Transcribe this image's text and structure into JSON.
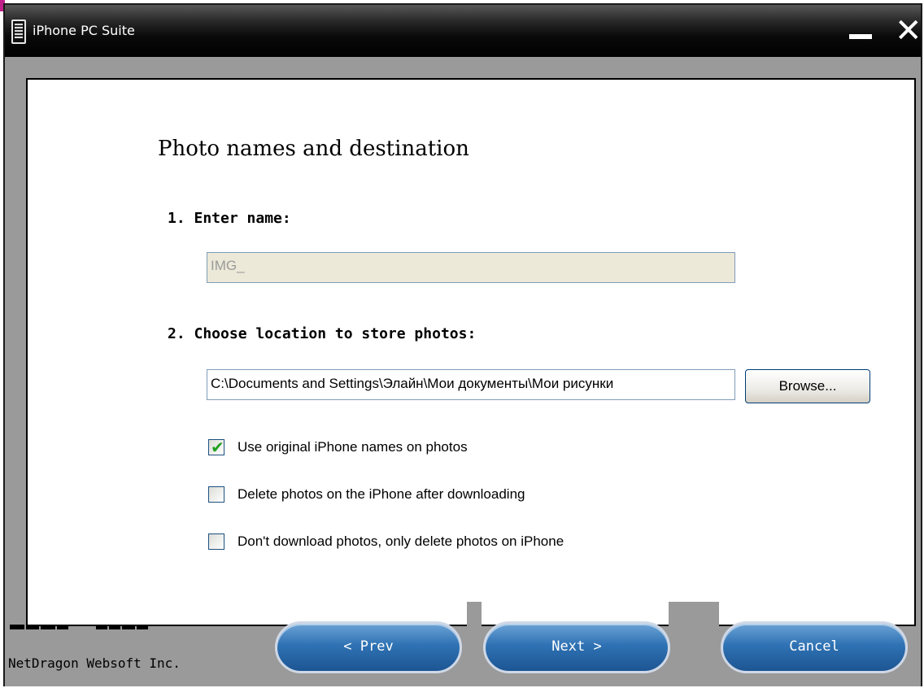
{
  "window": {
    "title": "iPhone PC Suite",
    "minimize_glyph": "—",
    "close_glyph": "✕"
  },
  "page": {
    "heading": "Photo names and destination",
    "step1_label": "1. Enter name:",
    "name_value": "IMG_",
    "step2_label": "2. Choose location to store photos:",
    "path_value": "C:\\Documents and Settings\\Элайн\\Мои документы\\Мои рисунки",
    "browse_label": "Browse..."
  },
  "options": [
    {
      "label": "Use original iPhone names on photos",
      "checked": true
    },
    {
      "label": "Delete photos on the iPhone after downloading",
      "checked": false
    },
    {
      "label": "Don't download photos, only delete photos on iPhone",
      "checked": false
    }
  ],
  "footer": {
    "company": "NetDragon Websoft Inc.",
    "prev_label": "< Prev",
    "next_label": "Next >",
    "cancel_label": "Cancel"
  },
  "colors": {
    "button_blue": "#2f72b4",
    "check_green": "#21a121",
    "title_bar": "#000000"
  }
}
